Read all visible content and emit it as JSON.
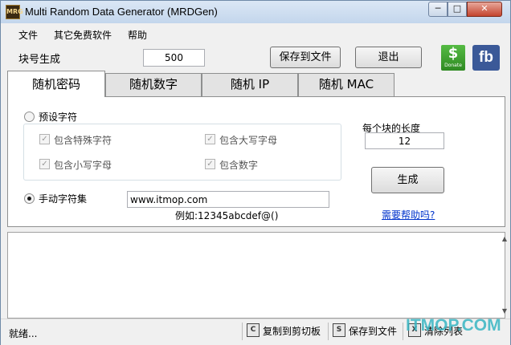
{
  "window": {
    "title": "Multi Random Data Generator (MRDGen)",
    "icon_text": "MRG"
  },
  "menu": [
    "文件",
    "其它免费软件",
    "帮助"
  ],
  "top": {
    "block_label": "块号生成",
    "block_value": "500",
    "save_button": "保存到文件",
    "exit_button": "退出",
    "donate_text": "Donate",
    "donate_symbol": "$",
    "fb_text": "fb"
  },
  "tabs": [
    {
      "label": "随机密码",
      "active": true
    },
    {
      "label": "随机数字",
      "active": false
    },
    {
      "label": "随机 IP",
      "active": false
    },
    {
      "label": "随机 MAC",
      "active": false
    }
  ],
  "password": {
    "preset_label": "预设字符",
    "preset_selected": false,
    "options": [
      {
        "label": "包含特殊字符",
        "checked": true
      },
      {
        "label": "包含大写字母",
        "checked": true
      },
      {
        "label": "包含小写字母",
        "checked": true
      },
      {
        "label": "包含数字",
        "checked": true
      }
    ],
    "manual_label": "手动字符集",
    "manual_selected": true,
    "manual_value": "www.itmop.com",
    "example": "例如:12345abcdef@()",
    "length_label": "每个块的长度",
    "length_value": "12",
    "generate_button": "生成",
    "help_link": "需要帮助吗?"
  },
  "status": {
    "text": "就绪...",
    "copy": "复制到剪切板",
    "save": "保存到文件",
    "clear": "清除列表"
  },
  "watermark": "ITMOP.COM"
}
